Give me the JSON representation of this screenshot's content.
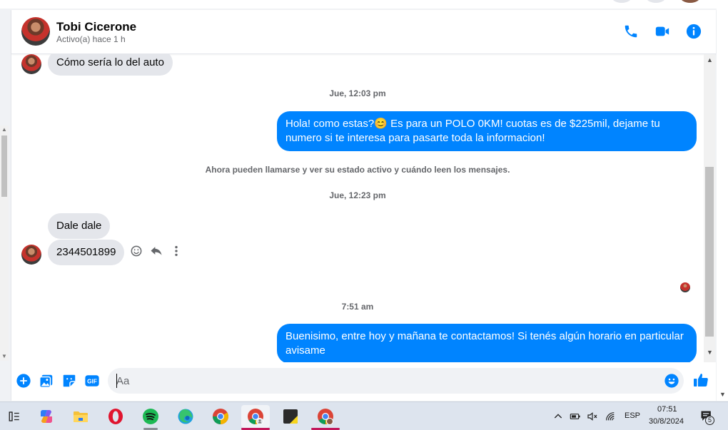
{
  "header": {
    "contact_name": "Tobi Cicerone",
    "status": "Activo(a) hace 1 h",
    "actions": [
      "phone-call",
      "video-call",
      "conversation-info"
    ],
    "accent": "#0084ff"
  },
  "messages": {
    "partial_top": {
      "text": "Cómo sería lo del auto"
    },
    "ts1": "Jue, 12:03 pm",
    "out1": "Hola! como estas?😊 Es para un POLO 0KM! cuotas es de $225mil, dejame tu numero si te interesa para pasarte toda la informacion!",
    "notice": "Ahora pueden llamarse y ver su estado activo y cuándo leen los mensajes.",
    "ts2": "Jue, 12:23 pm",
    "in1": "Dale dale",
    "in2": "2344501899",
    "ts3": "7:51 am",
    "out2": "Buenisimo, entre hoy y mañana te contactamos! Si tenés algún horario en particular avisame"
  },
  "composer": {
    "placeholder": "Aa",
    "buttons": [
      "add",
      "photo",
      "sticker",
      "gif",
      "emoji",
      "like"
    ]
  },
  "taskbar": {
    "apps": [
      "task-view",
      "copilot",
      "file-explorer",
      "opera",
      "spotify",
      "edge",
      "chrome",
      "chrome-profile",
      "sticky-notes",
      "chrome-2"
    ],
    "language": "ESP",
    "time": "07:51",
    "date": "30/8/2024",
    "notifications": "5"
  }
}
